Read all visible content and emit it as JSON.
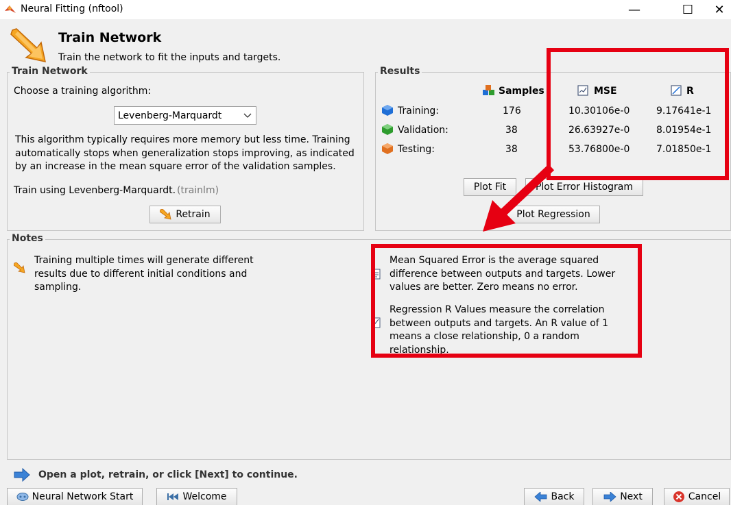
{
  "window": {
    "title": "Neural Fitting (nftool)",
    "minimize": "—",
    "maximize": "☐",
    "close": "✕"
  },
  "header": {
    "title": "Train Network",
    "subtitle": "Train the network to fit the inputs and targets."
  },
  "train_network": {
    "group_label": "Train Network",
    "choose_label": "Choose a training algorithm:",
    "algorithm_selected": "Levenberg-Marquardt",
    "description": "This algorithm typically requires more memory but less time. Training automatically stops when generalization stops improving, as indicated by an increase in the mean square error of the validation samples.",
    "train_using": "Train using Levenberg-Marquardt.",
    "train_fn": "(trainlm)",
    "retrain_label": "Retrain"
  },
  "results": {
    "group_label": "Results",
    "headers": {
      "samples": "Samples",
      "mse": "MSE",
      "r": "R"
    },
    "rows": [
      {
        "label": "Training:",
        "samples": "176",
        "mse": "10.30106e-0",
        "r": "9.17641e-1",
        "color": "#1f6fd6"
      },
      {
        "label": "Validation:",
        "samples": "38",
        "mse": "26.63927e-0",
        "r": "8.01954e-1",
        "color": "#2e9c2e"
      },
      {
        "label": "Testing:",
        "samples": "38",
        "mse": "53.76800e-0",
        "r": "7.01850e-1",
        "color": "#e07020"
      }
    ],
    "plot_fit_label": "Plot Fit",
    "plot_error_hist_label": "Plot Error Histogram",
    "plot_regression_label": "Plot Regression"
  },
  "notes": {
    "group_label": "Notes",
    "note_main": "Training multiple times will generate different results due to different initial conditions and sampling.",
    "note_mse": "Mean Squared Error is the average squared difference between outputs and targets. Lower values are better. Zero means no error.",
    "note_r": "Regression R Values measure the correlation between outputs and targets. An R value of 1 means a close relationship, 0 a random relationship."
  },
  "footer": {
    "hint": "Open a plot, retrain, or click [Next] to continue.",
    "nn_start_label": "Neural Network Start",
    "welcome_label": "Welcome",
    "back_label": "Back",
    "next_label": "Next",
    "cancel_label": "Cancel"
  },
  "annotation_color": "#e60012"
}
